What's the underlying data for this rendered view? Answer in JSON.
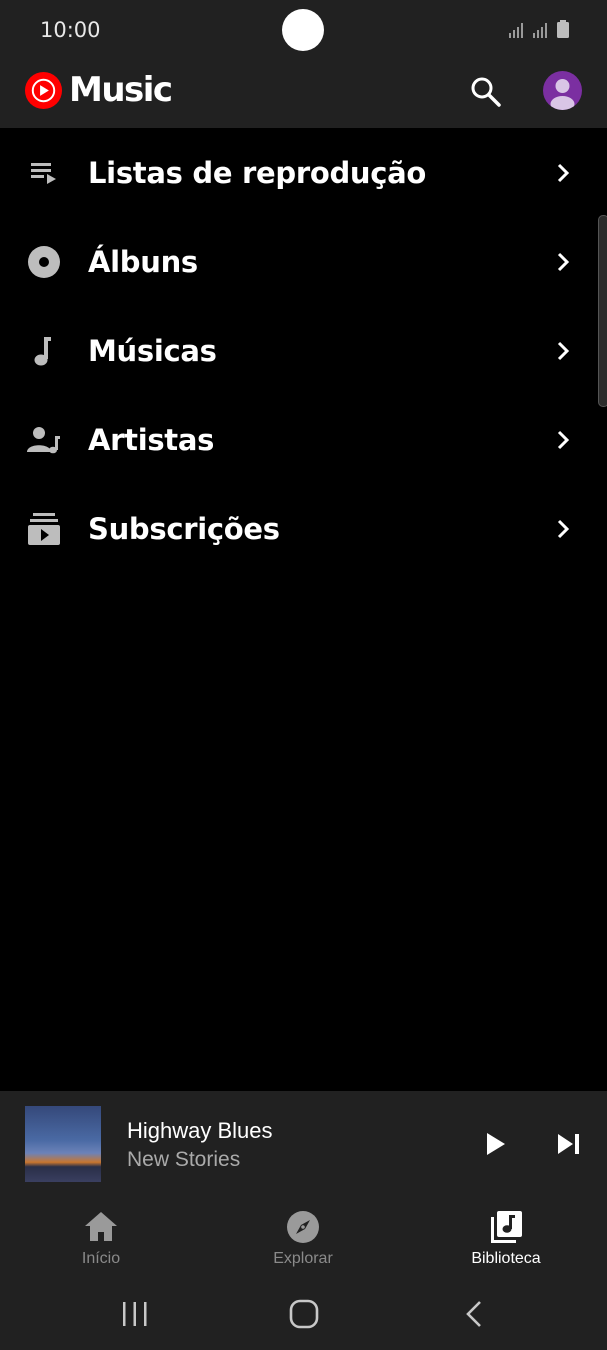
{
  "status": {
    "time": "10:00"
  },
  "app": {
    "logo_text": "Music"
  },
  "library_items": [
    {
      "label": "Listas de reprodução",
      "icon": "playlist-icon"
    },
    {
      "label": "Álbuns",
      "icon": "album-icon"
    },
    {
      "label": "Músicas",
      "icon": "music-note-icon"
    },
    {
      "label": "Artistas",
      "icon": "artist-icon"
    },
    {
      "label": "Subscrições",
      "icon": "subscriptions-icon"
    }
  ],
  "mini_player": {
    "title": "Highway Blues",
    "artist": "New Stories"
  },
  "bottom_nav": [
    {
      "label": "Início",
      "icon": "home-icon"
    },
    {
      "label": "Explorar",
      "icon": "compass-icon"
    },
    {
      "label": "Biblioteca",
      "icon": "library-icon",
      "active": true
    }
  ],
  "colors": {
    "brand_red": "#ff0000",
    "avatar": "#7b2fa1",
    "surface": "#212121",
    "background": "#000000"
  }
}
